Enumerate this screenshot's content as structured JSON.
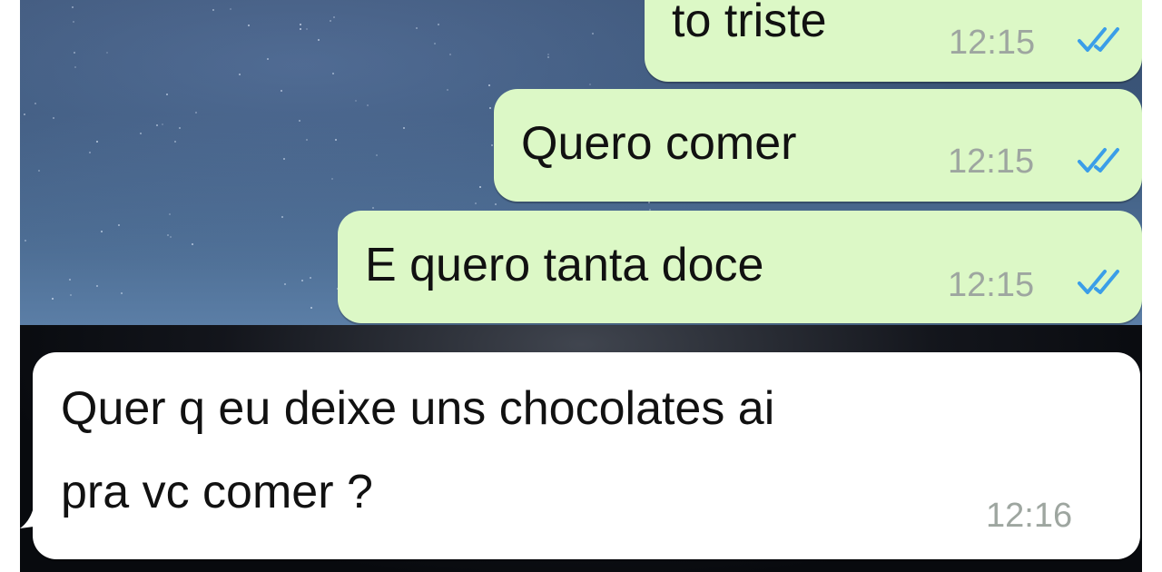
{
  "messages": [
    {
      "direction": "outgoing",
      "text": "to triste",
      "time": "12:15",
      "status": "read",
      "status_icon": "double-check-icon"
    },
    {
      "direction": "outgoing",
      "text": "Quero comer",
      "time": "12:15",
      "status": "read",
      "status_icon": "double-check-icon"
    },
    {
      "direction": "outgoing",
      "text": "E quero tanta doce",
      "time": "12:15",
      "status": "read",
      "status_icon": "double-check-icon"
    },
    {
      "direction": "incoming",
      "text_lines": [
        "Quer q eu deixe uns chocolates ai",
        "pra vc comer ?"
      ],
      "time": "12:16"
    }
  ],
  "colors": {
    "outgoing_bubble": "#dcf8c6",
    "incoming_bubble": "#ffffff",
    "read_ticks": "#3b9ee8",
    "timestamp": "#9ea6a0"
  }
}
